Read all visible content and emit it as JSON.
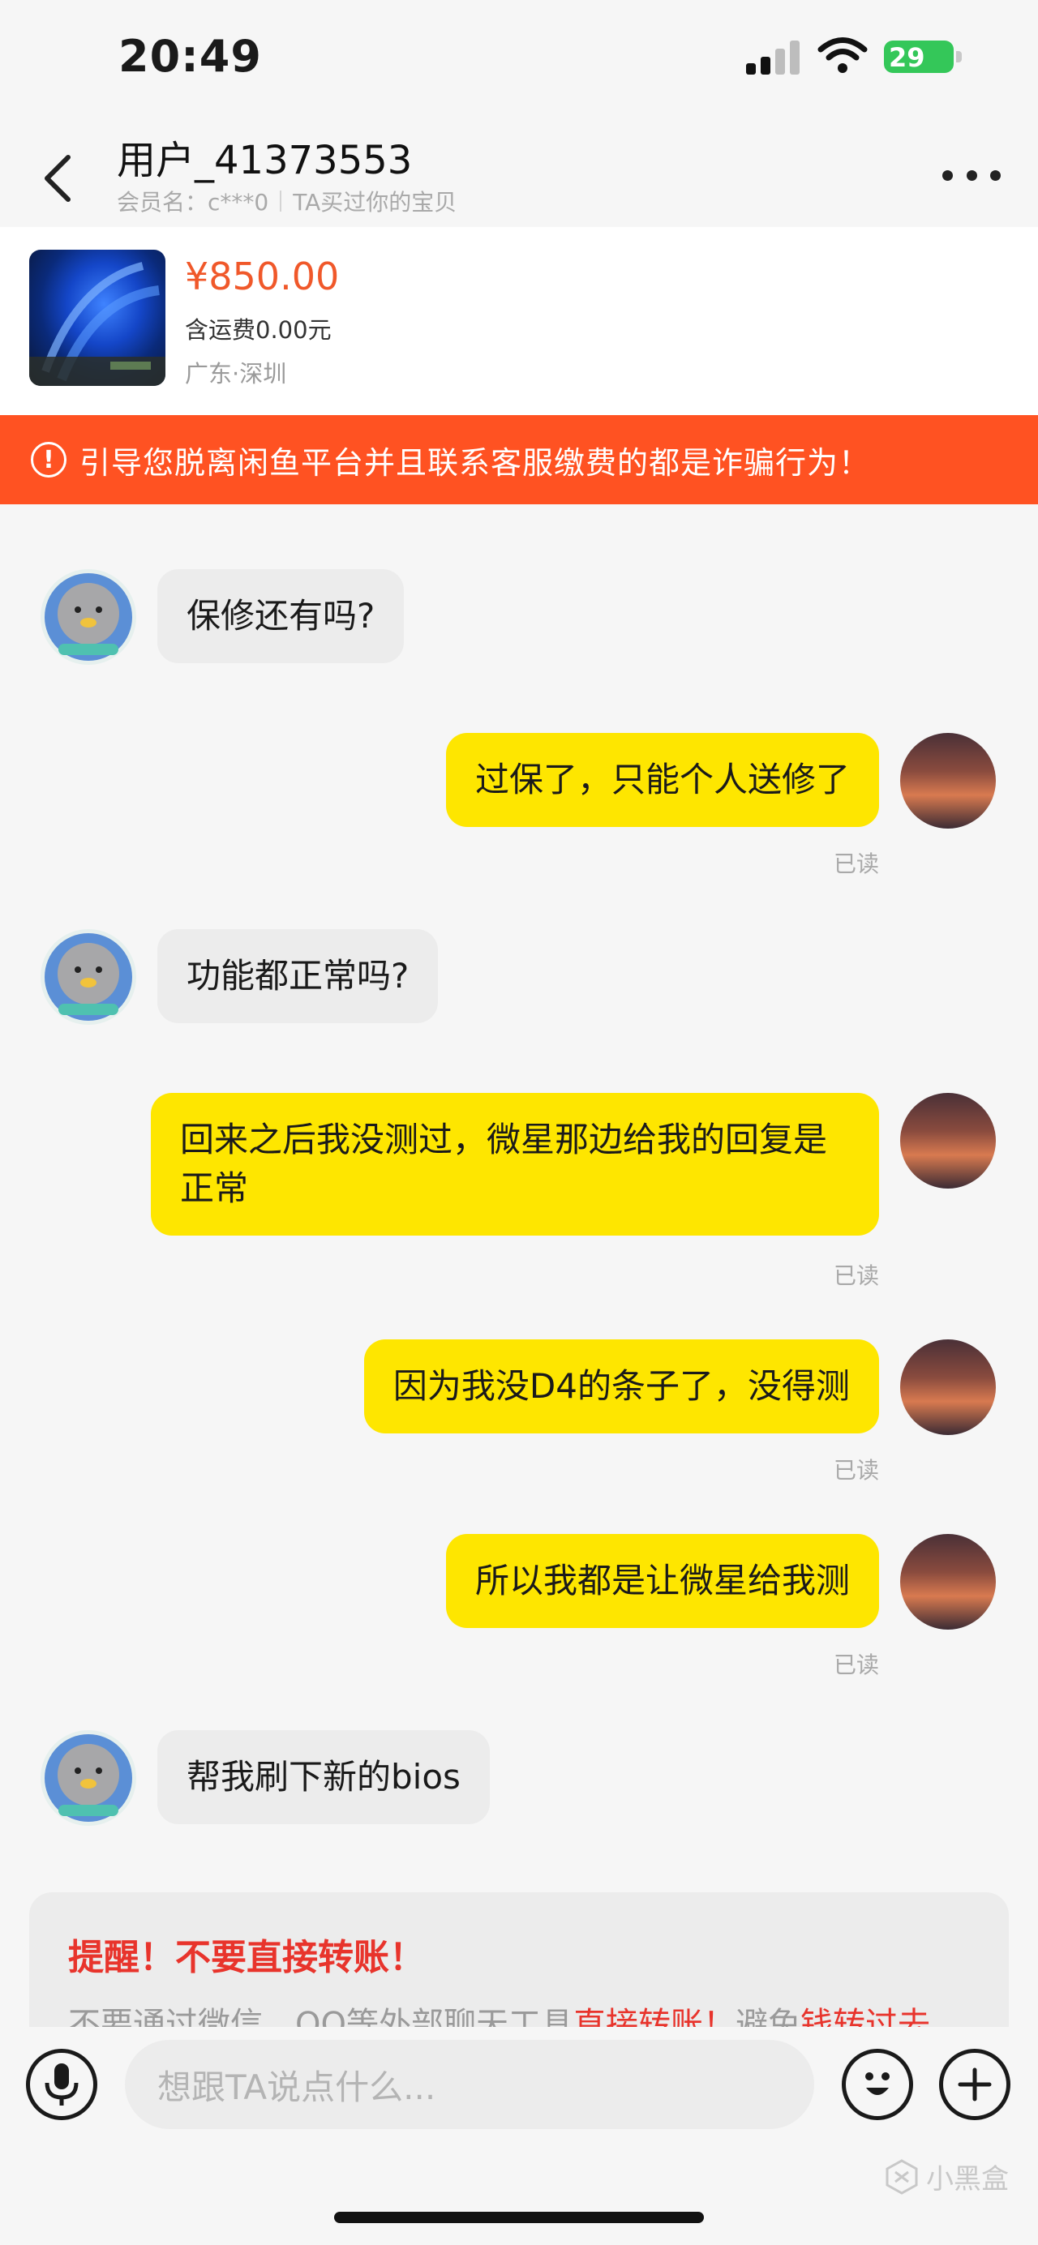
{
  "status": {
    "time": "20:49",
    "battery": "29"
  },
  "header": {
    "title": "用户_41373553",
    "member_name": "会员名：c***0",
    "relation": "TA买过你的宝贝"
  },
  "product": {
    "price": "¥850.00",
    "shipping": "含运费0.00元",
    "location": "广东·深圳"
  },
  "warning": {
    "icon": "!",
    "text": "引导您脱离闲鱼平台并且联系客服缴费的都是诈骗行为！"
  },
  "messages": [
    {
      "from": "other",
      "text": "保修还有吗?"
    },
    {
      "from": "me",
      "text": "过保了，只能个人送修了",
      "status": "已读"
    },
    {
      "from": "other",
      "text": "功能都正常吗?"
    },
    {
      "from": "me",
      "text": "回来之后我没测过，微星那边给我的回复是正常",
      "status": "已读"
    },
    {
      "from": "me",
      "text": "因为我没D4的条子了，没得测",
      "status": "已读"
    },
    {
      "from": "me",
      "text": "所以我都是让微星给我测",
      "status": "已读"
    },
    {
      "from": "other",
      "text": "帮我刷下新的bios"
    }
  ],
  "reminder": {
    "title": "提醒！不要直接转账！",
    "body_part1": "不要通过微信、QQ等外部聊天工具",
    "body_highlight1": "直接转账！",
    "body_part2": "避免",
    "body_highlight2": "钱转过去"
  },
  "input": {
    "placeholder": "想跟TA说点什么..."
  },
  "watermark": "小黑盒",
  "colors": {
    "accent_orange": "#ff5222",
    "price": "#f0582a",
    "bubble_out": "#fee600",
    "bubble_in": "#ececec",
    "reminder_red": "#e8342c"
  }
}
